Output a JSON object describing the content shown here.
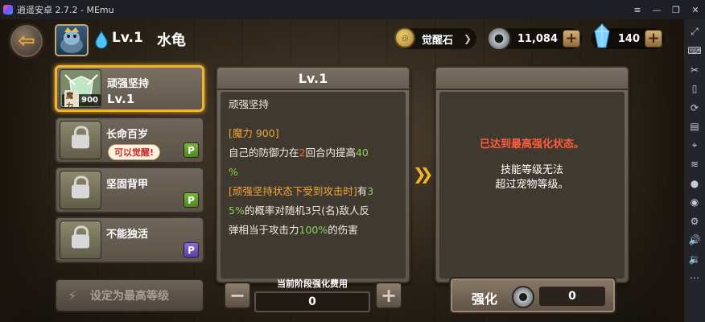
{
  "window": {
    "title": "逍遥安卓 2.7.2 - MEmu"
  },
  "header": {
    "pet_level": "Lv.1",
    "pet_name": "水龟",
    "awaken_stone_label": "觉醒石",
    "gear_count": "11,084",
    "gem_count": "140"
  },
  "skills": [
    {
      "name": "顽强坚持",
      "level": "Lv.1",
      "mana_label": "魔力",
      "mana_value": "900",
      "selected": true,
      "locked": false,
      "badge": ""
    },
    {
      "name": "长命百岁",
      "tip": "可以觉醒!",
      "locked": true,
      "badge": "P",
      "badge_color": "#5f9a2c"
    },
    {
      "name": "坚固背甲",
      "locked": true,
      "badge": "P",
      "badge_color": "#5f9a2c"
    },
    {
      "name": "不能独活",
      "locked": true,
      "badge": "P",
      "badge_color": "#6b4fc0"
    }
  ],
  "detail": {
    "level": "Lv.1",
    "skill_name": "顽强坚持",
    "line_mana": "[魔力 900]",
    "line1a": "自己的防御力在",
    "line1b": "2",
    "line1c": "回合内提高",
    "line1d": "40",
    "line2": "%",
    "line3a": "[顽强坚持状态下受到攻击时]",
    "line3b": "有",
    "line3c": "3",
    "line4a": "5%",
    "line4b": "的概率对随机3只(名)敌人反",
    "line5a": "弹相当于攻击力",
    "line5b": "100%",
    "line5c": "的伤害"
  },
  "result": {
    "max_message": "已达到最高强化状态。",
    "cannot_line1": "技能等级无法",
    "cannot_line2": "超过宠物等级。"
  },
  "bottom": {
    "set_max_label": "设定为最高等级",
    "cost_label": "当前阶段强化费用",
    "cost_value": "0",
    "minus": "−",
    "plus": "+",
    "enhance_label": "强化",
    "enhance_cost": "0"
  },
  "icons": {
    "back": "back-arrow-icon",
    "awaken_stone": "awaken-stone-icon",
    "gear": "gear-coin-icon",
    "gem": "blue-gem-icon",
    "lock": "lock-icon"
  },
  "colors": {
    "selected_border": "#f3b42a",
    "red_text": "#ff5b3d",
    "orange_text": "#f3a63a",
    "green_text": "#8cd05a"
  }
}
